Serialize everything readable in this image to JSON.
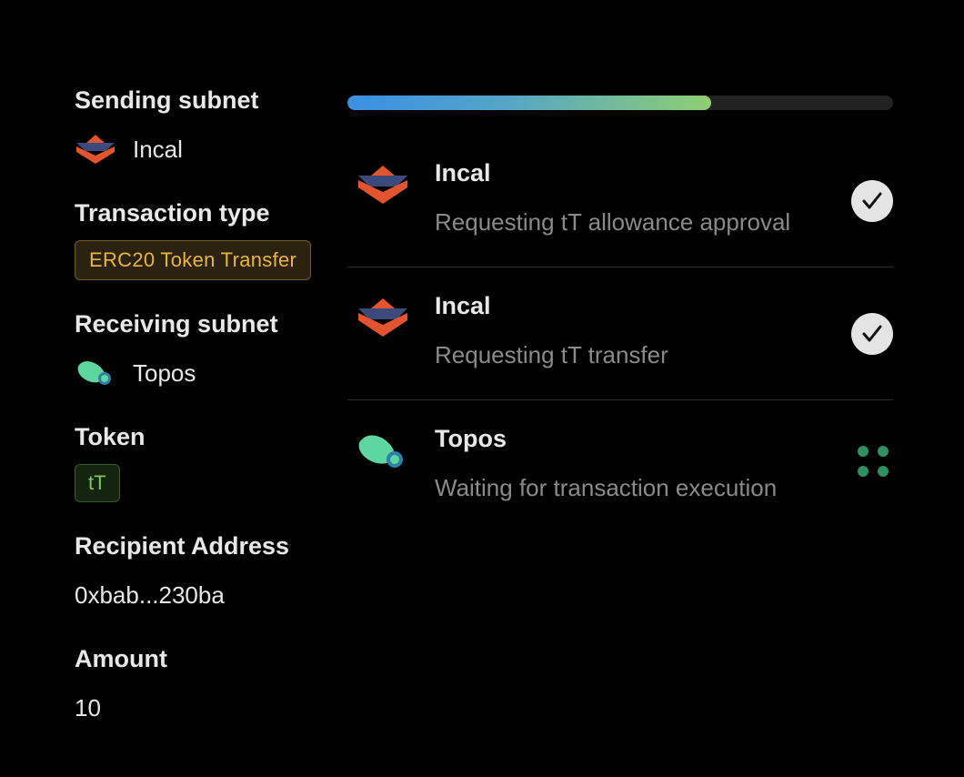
{
  "details": {
    "sending_subnet_label": "Sending subnet",
    "sending_subnet_name": "Incal",
    "transaction_type_label": "Transaction type",
    "transaction_type_value": "ERC20 Token Transfer",
    "receiving_subnet_label": "Receiving subnet",
    "receiving_subnet_name": "Topos",
    "token_label": "Token",
    "token_value": "tT",
    "recipient_label": "Recipient Address",
    "recipient_value": "0xbab...230ba",
    "amount_label": "Amount",
    "amount_value": "10"
  },
  "progress": {
    "percent": 66.7
  },
  "steps": [
    {
      "subnet": "Incal",
      "description": "Requesting tT allowance approval",
      "status": "done",
      "icon": "incal-logo-icon"
    },
    {
      "subnet": "Incal",
      "description": "Requesting tT transfer",
      "status": "done",
      "icon": "incal-logo-icon"
    },
    {
      "subnet": "Topos",
      "description": "Waiting for transaction execution",
      "status": "pending",
      "icon": "topos-logo-icon"
    }
  ],
  "colors": {
    "incal_primary": "#e2542e",
    "incal_secondary": "#3b4a7a",
    "topos_primary": "#5dd6a0",
    "topos_secondary": "#2f7fa8",
    "badge_type_text": "#e8b447",
    "badge_token_text": "#7ec95c",
    "progress_start": "#3a8fe4",
    "progress_end": "#8fce72",
    "spinner": "#2f8f5f"
  }
}
